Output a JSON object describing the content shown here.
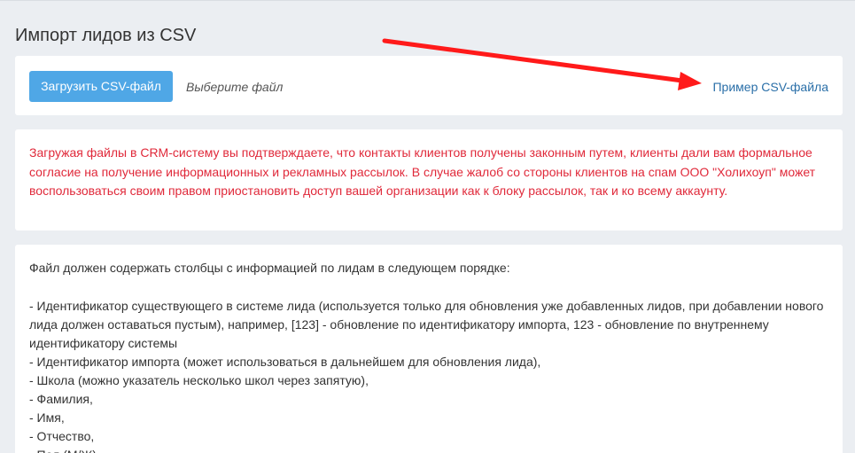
{
  "page": {
    "title": "Импорт лидов из CSV"
  },
  "upload": {
    "button_label": "Загрузить CSV-файл",
    "file_hint": "Выберите файл",
    "sample_link": "Пример CSV-файла"
  },
  "warning": {
    "text": "Загружая файлы в CRM-систему вы подтверждаете, что контакты клиентов получены законным путем, клиенты дали вам формальное согласие на получение информационных и рекламных рассылок. В случае жалоб со стороны клиентов на спам ООО \"Холихоуп\" может воспользоваться своим правом приостановить доступ вашей организации как к блоку рассылок, так и ко всему аккаунту."
  },
  "info": {
    "intro": "Файл должен содержать столбцы с информацией по лидам в следующем порядке:",
    "items": [
      "- Идентификатор существующего в системе лида (используется только для обновления уже добавленных лидов, при добавлении нового лида должен оставаться пустым), например, [123] - обновление по идентификатору импорта, 123 - обновление по внутреннему идентификатору системы",
      "- Идентификатор импорта (может использоваться в дальнейшем для обновления лида),",
      "- Школа (можно указатель несколько школ через запятую),",
      "- Фамилия,",
      "- Имя,",
      "- Отчество,",
      "- Пол (М/Ж),"
    ]
  },
  "colors": {
    "primary_button": "#4fa7e6",
    "link": "#2a6fa8",
    "warning_text": "#e0293a",
    "annotation_arrow": "#ff1a1a"
  }
}
